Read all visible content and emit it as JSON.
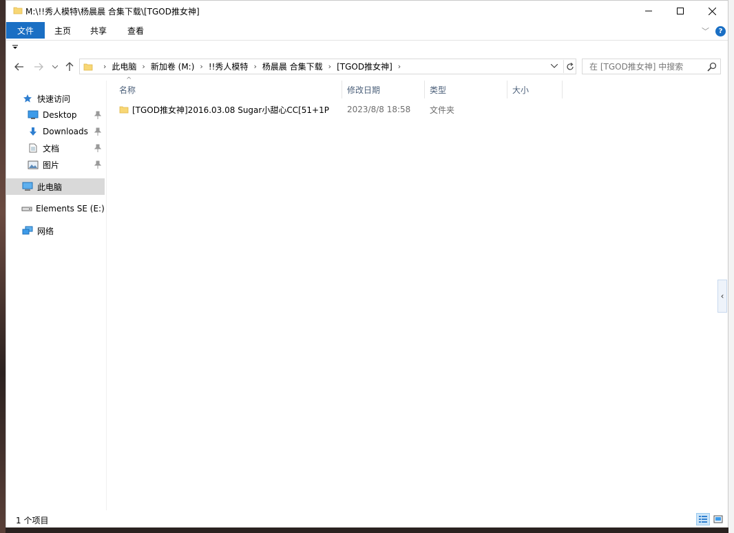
{
  "window": {
    "title": "M:\\!!秀人模特\\杨晨晨 合集下载\\[TGOD推女神]"
  },
  "ribbon": {
    "tabs": [
      "文件",
      "主页",
      "共享",
      "查看"
    ],
    "help_label": "?"
  },
  "address": {
    "crumbs": [
      "此电脑",
      "新加卷 (M:)",
      "!!秀人模特",
      "杨晨晨 合集下载",
      "[TGOD推女神]"
    ]
  },
  "search": {
    "placeholder": "在 [TGOD推女神] 中搜索"
  },
  "navpane": {
    "quick_access": "快速访问",
    "items": [
      {
        "label": "Desktop",
        "icon": "desktop-icon",
        "pinned": true
      },
      {
        "label": "Downloads",
        "icon": "downloads-icon",
        "pinned": true
      },
      {
        "label": "文档",
        "icon": "documents-icon",
        "pinned": true
      },
      {
        "label": "图片",
        "icon": "pictures-icon",
        "pinned": true
      }
    ],
    "this_pc": "此电脑",
    "drive": "Elements SE (E:)",
    "network": "网络"
  },
  "columns": [
    "名称",
    "修改日期",
    "类型",
    "大小"
  ],
  "files": [
    {
      "name": "[TGOD推女神]2016.03.08 Sugar小甜心CC[51+1P",
      "date": "2023/8/8 18:58",
      "type": "文件夹",
      "size": ""
    }
  ],
  "status": {
    "count": "1 个项目"
  },
  "colors": {
    "accent": "#1a6fc4",
    "selected_nav": "#d9d9d9",
    "folder": "#f8d775"
  }
}
